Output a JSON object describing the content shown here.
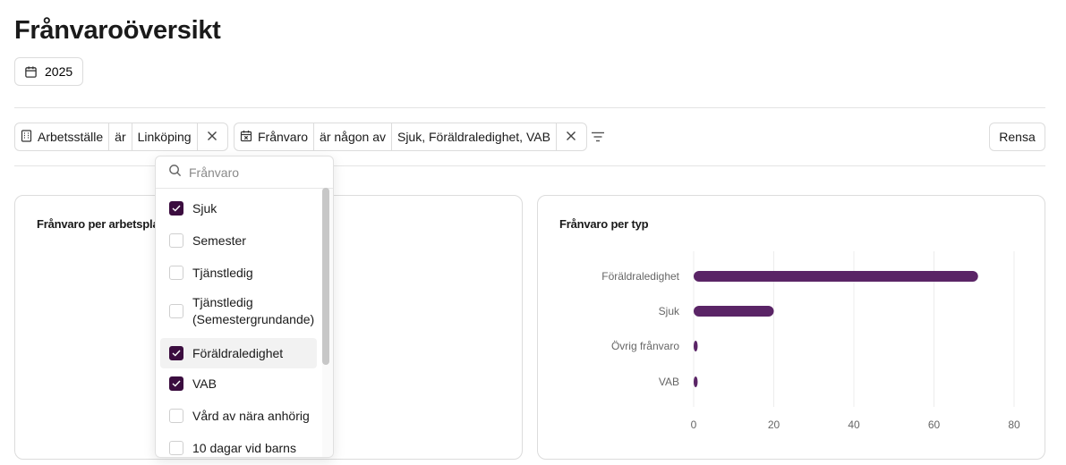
{
  "page": {
    "title": "Frånvaroöversikt"
  },
  "year_selector": {
    "value": "2025",
    "icon": "calendar-icon"
  },
  "filters": [
    {
      "field": "Arbetsställe",
      "field_icon": "building-icon",
      "operator": "är",
      "value": "Linköping"
    },
    {
      "field": "Frånvaro",
      "field_icon": "calendar-x-icon",
      "operator": "är någon av",
      "value": "Sjuk, Föräldraledighet, VAB"
    }
  ],
  "clear_button": {
    "label": "Rensa"
  },
  "dropdown": {
    "placeholder": "Frånvaro",
    "options": [
      {
        "label": "Sjuk",
        "checked": true
      },
      {
        "label": "Semester",
        "checked": false
      },
      {
        "label": "Tjänstledig",
        "checked": false
      },
      {
        "label": "Tjänstledig (Semestergrundande)",
        "line1": "Tjänstledig",
        "line2": "(Semestergrundande)",
        "checked": false
      },
      {
        "label": "Föräldraledighet",
        "checked": true
      },
      {
        "label": "VAB",
        "checked": true
      },
      {
        "label": "Vård av nära anhörig",
        "checked": false
      },
      {
        "label": "10 dagar vid barns",
        "checked": false
      }
    ]
  },
  "cards": {
    "left": {
      "title": "Frånvaro per arbetsplats"
    },
    "right": {
      "title": "Frånvaro per typ"
    }
  },
  "chart_data": {
    "type": "bar",
    "orientation": "horizontal",
    "categories": [
      "Föräldraledighet",
      "Sjuk",
      "Övrig frånvaro",
      "VAB"
    ],
    "values": [
      71,
      20,
      1,
      1
    ],
    "xlim": [
      0,
      80
    ],
    "xticks": [
      0,
      20,
      40,
      60,
      80
    ],
    "grid": true,
    "bar_color": "#5a2466"
  },
  "colors": {
    "accent": "#3b0d3f",
    "bar": "#5a2466",
    "border": "#dcdcdc"
  }
}
